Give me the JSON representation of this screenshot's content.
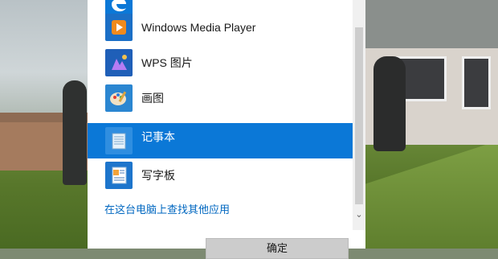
{
  "apps": [
    {
      "label": "",
      "icon": "edge-icon",
      "color": "#0b78d7"
    },
    {
      "label": "Windows Media Player",
      "icon": "media-player-icon",
      "color": "#1b6fc6"
    },
    {
      "label": "WPS 图片",
      "icon": "wps-picture-icon",
      "color": "#1f5fb8"
    },
    {
      "label": "画图",
      "icon": "paint-icon",
      "color": "#2b86d1"
    },
    {
      "label": "记事本",
      "icon": "notepad-icon",
      "color": "#2f8ee0",
      "selected": true
    },
    {
      "label": "写字板",
      "icon": "wordpad-icon",
      "color": "#1d75cc"
    }
  ],
  "find_link": "在这台电脑上查找其他应用",
  "ok_button": "确定",
  "scroll": {
    "down_arrow": "⌄"
  }
}
